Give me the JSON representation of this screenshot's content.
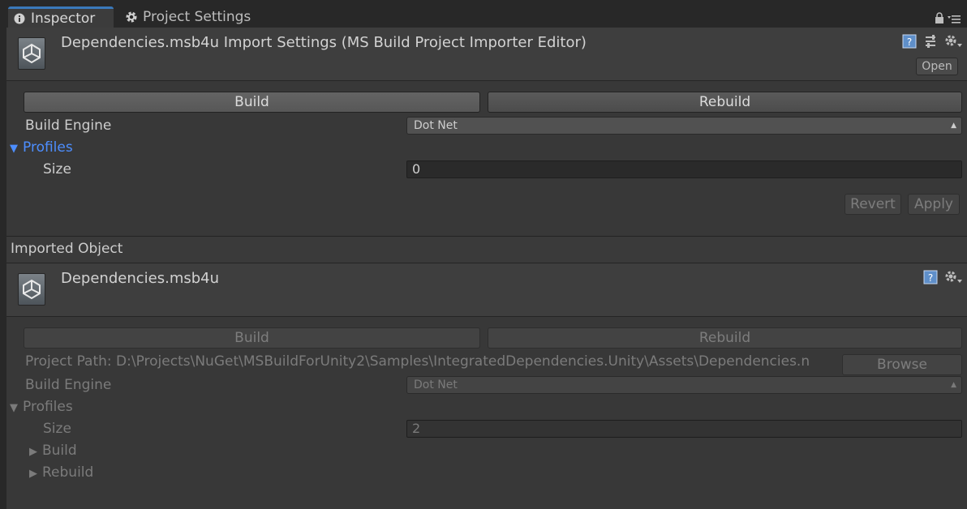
{
  "tabs": [
    {
      "label": "Inspector",
      "icon": "info-icon"
    },
    {
      "label": "Project Settings",
      "icon": "gear-icon"
    }
  ],
  "colors": {
    "accent": "#3a79bb",
    "foldout_active": "#4d8eff",
    "background": "#383838"
  },
  "importer": {
    "title": "Dependencies.msb4u Import Settings (MS Build Project Importer Editor)",
    "open_label": "Open",
    "build_label": "Build",
    "rebuild_label": "Rebuild",
    "build_engine_label": "Build Engine",
    "build_engine_value": "Dot Net",
    "profiles_label": "Profiles",
    "size_label": "Size",
    "size_value": "0",
    "revert_label": "Revert",
    "apply_label": "Apply"
  },
  "imported": {
    "section_label": "Imported Object",
    "title": "Dependencies.msb4u",
    "build_label": "Build",
    "rebuild_label": "Rebuild",
    "project_path_label": "Project Path:",
    "project_path_value": "D:\\Projects\\NuGet\\MSBuildForUnity2\\Samples\\IntegratedDependencies.Unity\\Assets\\Dependencies.n",
    "browse_label": "Browse",
    "build_engine_label": "Build Engine",
    "build_engine_value": "Dot Net",
    "profiles_label": "Profiles",
    "size_label": "Size",
    "size_value": "2",
    "profile_items": [
      "Build",
      "Rebuild"
    ]
  }
}
